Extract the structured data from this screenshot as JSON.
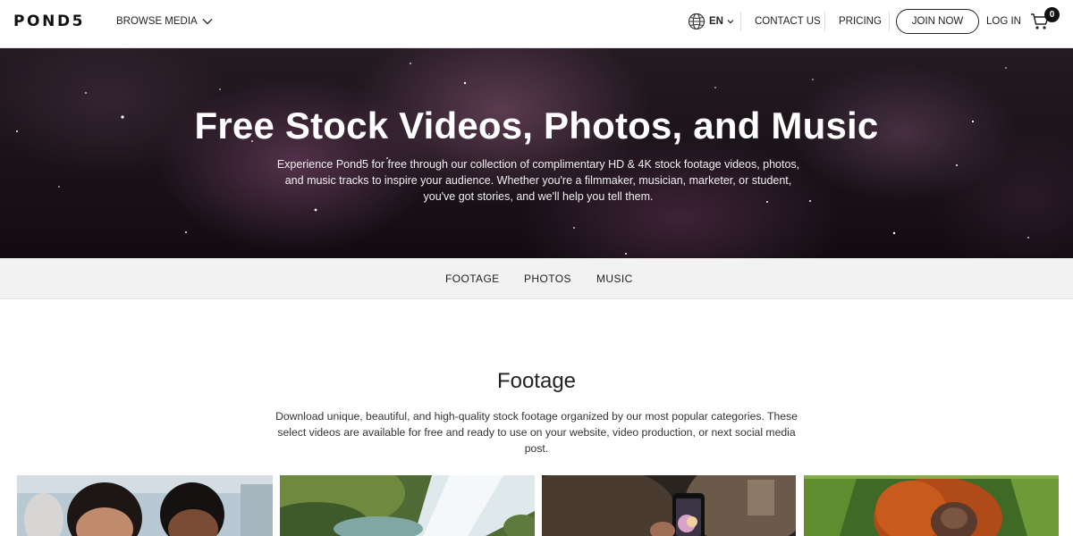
{
  "header": {
    "logo": "POND5",
    "browse_label": "BROWSE MEDIA",
    "lang_label": "EN",
    "contact_label": "CONTACT US",
    "pricing_label": "PRICING",
    "join_label": "JOIN NOW",
    "login_label": "LOG IN",
    "cart_count": "0",
    "icons": [
      "chevron-down-icon",
      "globe-icon",
      "cart-icon"
    ]
  },
  "hero": {
    "title": "Free Stock Videos, Photos, and Music",
    "description": "Experience Pond5 for free through our collection of complimentary HD & 4K stock footage videos, photos, and music tracks to inspire your audience. Whether you're a filmmaker, musician, marketer, or student, you've got stories, and we'll help you tell them."
  },
  "tabs": [
    "FOOTAGE",
    "PHOTOS",
    "MUSIC"
  ],
  "footage": {
    "title": "Footage",
    "description": "Download unique, beautiful, and high-quality stock footage organized by our most popular categories. These select videos are available for free and ready to use on your website, video production, or next social media post.",
    "thumbnails": [
      "two-men-smiling",
      "waterfall",
      "phone-in-hand",
      "orangutan"
    ]
  },
  "colors": {
    "text": "#222222",
    "tabs_bg": "#f2f2f2",
    "hero_bg": "#1a1219"
  }
}
